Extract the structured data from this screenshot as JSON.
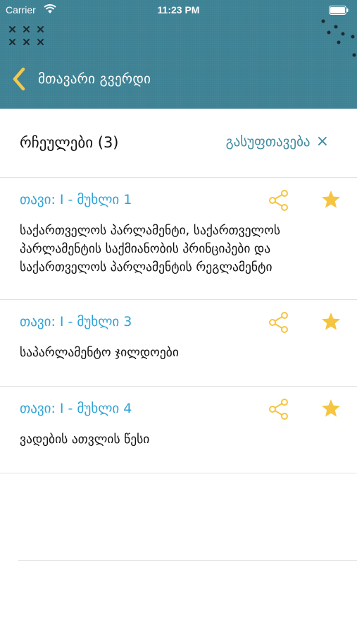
{
  "status": {
    "carrier": "Carrier",
    "time": "11:23 PM"
  },
  "nav": {
    "back_label": "მთავარი გვერდი"
  },
  "section": {
    "title": "რჩეულები (3)",
    "clear_label": "გასუფთავება",
    "clear_icon": "×"
  },
  "items": [
    {
      "title": "თავი: I - მუხლი 1",
      "body": "საქართველოს პარლამენტი, საქართველოს პარლამენტის საქმიანობის პრინციპები და საქართველოს პარლამენტის რეგლამენტი"
    },
    {
      "title": "თავი: I - მუხლი 3",
      "body": "საპარლამენტო ჯილდოები"
    },
    {
      "title": "თავი: I - მუხლი 4",
      "body": "ვადების ათვლის წესი"
    }
  ],
  "colors": {
    "header_bg": "#3d8194",
    "back_chevron": "#f2c94c",
    "item_title": "#2ea3d6",
    "icon_accent": "#f5c542",
    "clear_text": "#3f8aa0"
  }
}
